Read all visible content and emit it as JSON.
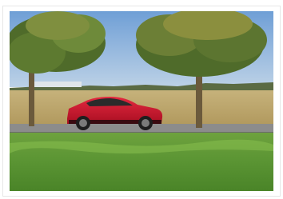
{
  "photo": {
    "subject": "red-crossover-car",
    "palette": {
      "sky_top": "#6f9fd6",
      "sky_bottom": "#bcd1e6",
      "field": "#b8a16a",
      "road": "#8c8c8c",
      "grass_dark": "#4f8f2d",
      "grass_light": "#7fb548",
      "car_body": "#c4122a",
      "tree_foliage": "#4f6b2a",
      "trunk": "#6b5a3c"
    }
  }
}
